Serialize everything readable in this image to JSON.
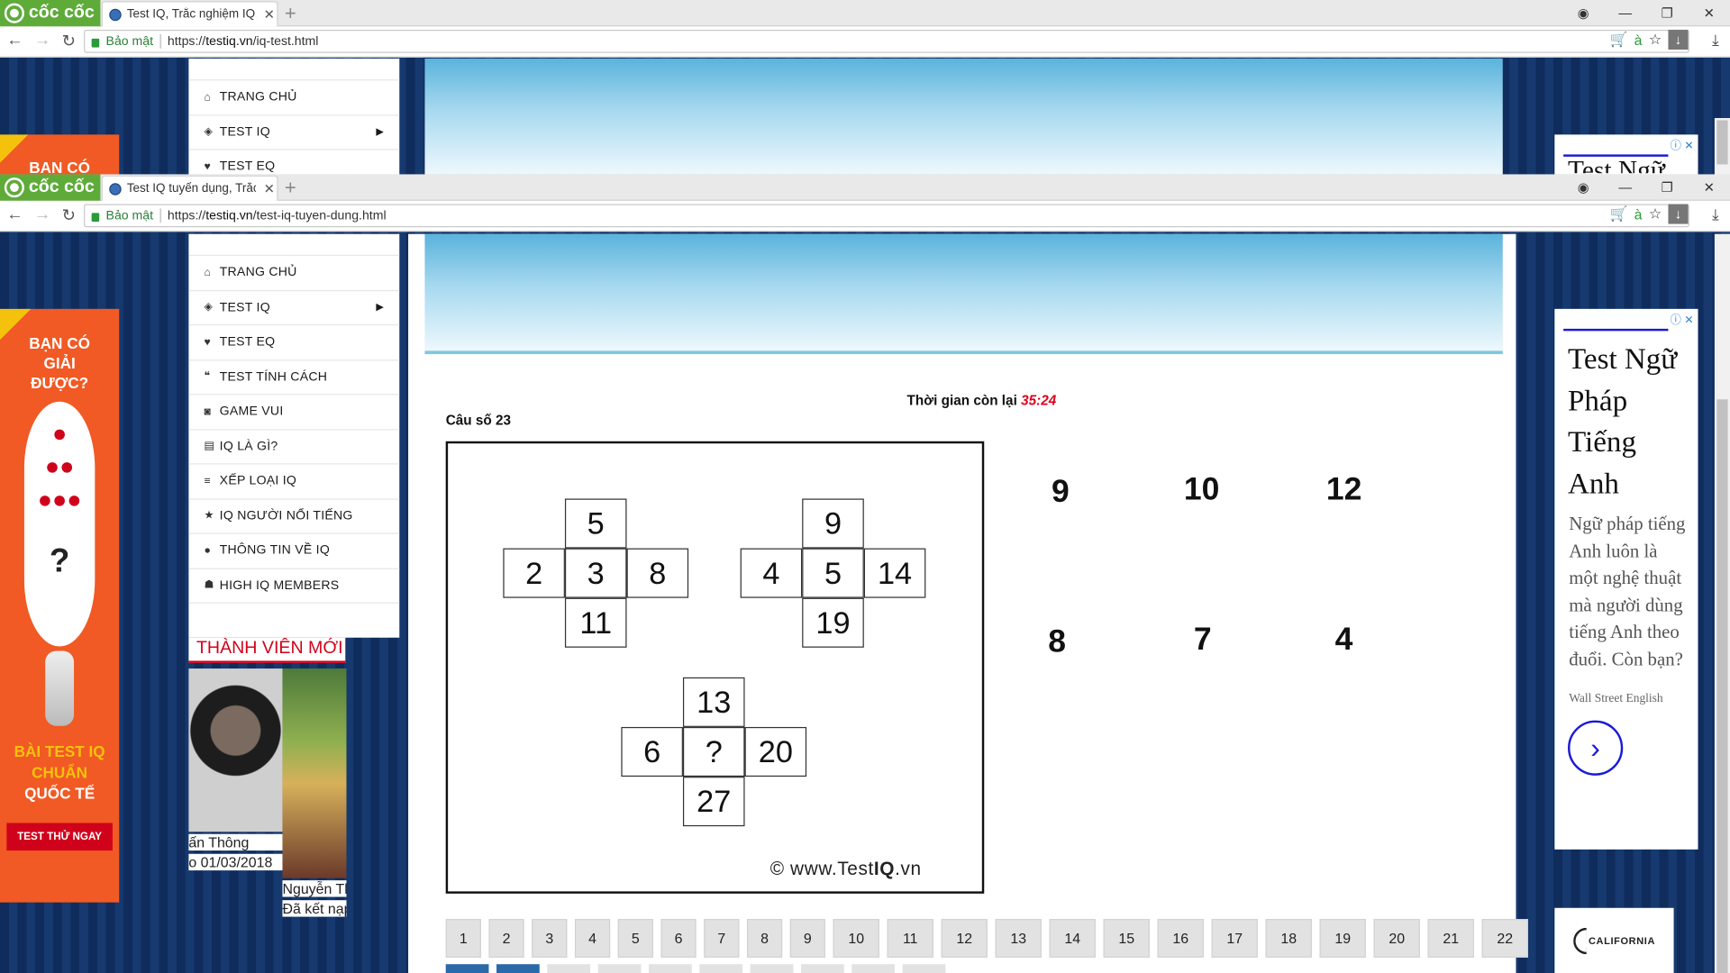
{
  "browser": {
    "brand": "cốc cốc",
    "window1": {
      "tab_title": "Test IQ, Trắc nghiệm IQ, K",
      "secure_label": "Bảo mật",
      "url_scheme": "https://",
      "url_host": "testiq.vn",
      "url_path": "/iq-test.html"
    },
    "window2": {
      "tab_title": "Test IQ tuyển dụng, Trắc n",
      "secure_label": "Bảo mật",
      "url_scheme": "https://",
      "url_host": "testiq.vn",
      "url_path": "/test-iq-tuyen-dung.html"
    }
  },
  "sidebar": {
    "items": [
      {
        "icon": "home-icon",
        "label": "TRANG CHỦ"
      },
      {
        "icon": "shield-icon",
        "label": "TEST IQ",
        "has_submenu": true
      },
      {
        "icon": "heart-icon",
        "label": "TEST EQ"
      },
      {
        "icon": "chat-icon",
        "label": "TEST TÍNH CÁCH"
      },
      {
        "icon": "gamepad-icon",
        "label": "GAME VUI"
      },
      {
        "icon": "book-icon",
        "label": "IQ LÀ GÌ?"
      },
      {
        "icon": "list-icon",
        "label": "XẾP LOẠI IQ"
      },
      {
        "icon": "star-icon",
        "label": "IQ NGƯỜI NỔI TIẾNG"
      },
      {
        "icon": "info-icon",
        "label": "THÔNG TIN VỀ IQ"
      },
      {
        "icon": "users-icon",
        "label": "HIGH IQ MEMBERS"
      }
    ],
    "window1_items": [
      {
        "icon": "home-icon",
        "label": "TRANG CHỦ"
      },
      {
        "icon": "shield-icon",
        "label": "TEST IQ",
        "has_submenu": true
      },
      {
        "icon": "heart-icon",
        "label": "TEST EQ"
      }
    ]
  },
  "members": {
    "title": "THÀNH VIÊN MỚI",
    "member1_name": "ấn Thông",
    "member1_date": "o 01/03/2018",
    "member2_name": "Nguyễn Th",
    "member2_status": "Đã kết nạp"
  },
  "quiz": {
    "timer_label": "Thời gian còn lại",
    "timer_value": "35:24",
    "timer_color": "#e0001b",
    "question_label": "Câu số 23",
    "crosses": [
      {
        "top": "5",
        "left": "2",
        "center": "3",
        "right": "8",
        "bottom": "11"
      },
      {
        "top": "9",
        "left": "4",
        "center": "5",
        "right": "14",
        "bottom": "19"
      },
      {
        "top": "13",
        "left": "6",
        "center": "?",
        "right": "20",
        "bottom": "27"
      }
    ],
    "watermark_prefix": "© www.Test",
    "watermark_bold": "IQ",
    "watermark_suffix": ".vn",
    "answers": [
      "9",
      "10",
      "12",
      "8",
      "7",
      "4"
    ]
  },
  "pager": {
    "pages": [
      "1",
      "2",
      "3",
      "4",
      "5",
      "6",
      "7",
      "8",
      "9",
      "10",
      "11",
      "12",
      "13",
      "14",
      "15",
      "16",
      "17",
      "18",
      "19",
      "20",
      "21",
      "22"
    ],
    "next_row_active": [
      true,
      true,
      false,
      false,
      false,
      false,
      false,
      false,
      false,
      false
    ]
  },
  "left_ad": {
    "headline": "BẠN CÓ GIẢI ĐƯỢC?",
    "headline_short": "BẠN CÓ",
    "question_mark": "?",
    "subline_1": "BÀI TEST IQ",
    "subline_2": "CHUẨN",
    "subline_3": "QUỐC TẾ",
    "cta": "TEST THỬ NGAY"
  },
  "right_ad": {
    "title": "Test Ngữ Pháp Tiếng Anh",
    "body": "Ngữ pháp tiếng Anh luôn là một nghệ thuật mà người dùng tiếng Anh theo đuổi. Còn bạn?",
    "sponsor": "Wall Street English",
    "peek_title": "Test Ngữ",
    "bottom_brand": "CALIFORNIA"
  },
  "colors": {
    "brand_green": "#5fab3a",
    "menu_red": "#d0021b",
    "ad_orange": "#f15a24",
    "ad_blue": "#1a1ad6",
    "pager_active": "#2b6aa8"
  }
}
